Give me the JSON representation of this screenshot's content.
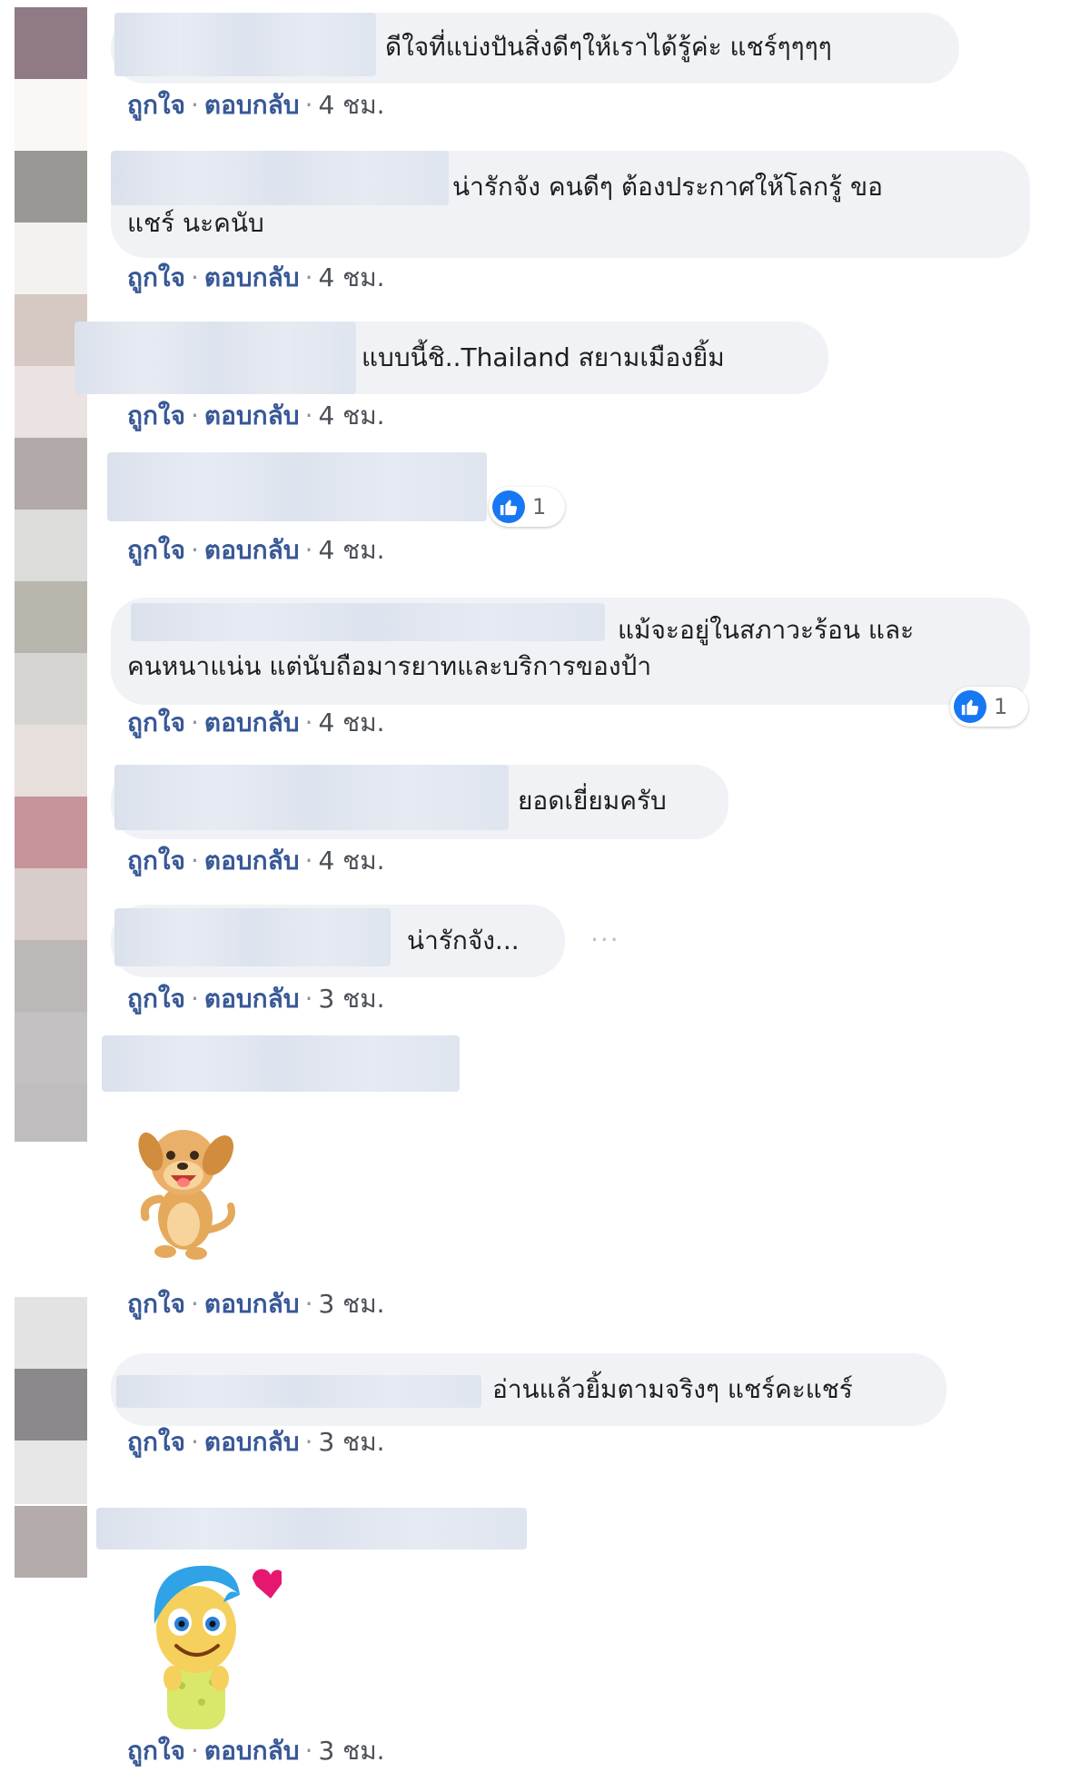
{
  "actions": {
    "like": "ถูกใจ",
    "reply": "ตอบกลับ",
    "separator": "·"
  },
  "comments": [
    {
      "text": "ดีใจที่แบ่งปันสิ่งดีๆให้เราได้รู้ค่ะ แชร์ๆๆๆๆ",
      "time": "4 ชม."
    },
    {
      "text_line1": "น่ารักจัง คนดีๆ ต้องประกาศให้โลกรู้ ขอ",
      "text_line2": "แชร์ นะคนับ",
      "time": "4 ชม."
    },
    {
      "text": "แบบนี้ชิ..Thailand สยามเมืองยิ้ม",
      "time": "4 ชม."
    },
    {
      "text": "",
      "time": "4 ชม.",
      "reactions": "1"
    },
    {
      "text_line1": "แม้จะอยู่ในสภาวะร้อน และ",
      "text_line2": "คนหนาแน่น แต่นับถือมารยาทและบริการของป้า",
      "time": "4 ชม.",
      "reactions": "1"
    },
    {
      "text": "ยอดเยี่ยมครับ",
      "time": "4 ชม."
    },
    {
      "text": "น่ารักจัง...",
      "time": "3 ชม.",
      "more": "···"
    },
    {
      "sticker": "dog-sticker",
      "time": "3 ชม."
    },
    {
      "text": "อ่านแล้วยิ้มตามจริงๆ แชร์คะแชร์",
      "time": "3 ชม."
    },
    {
      "sticker": "joy-heart-sticker",
      "time": "3 ชม."
    }
  ],
  "colors": {
    "bubble": "#f0f2f5",
    "action_link": "#385898",
    "like_blue": "#1877f2",
    "text": "#1c1e21"
  }
}
